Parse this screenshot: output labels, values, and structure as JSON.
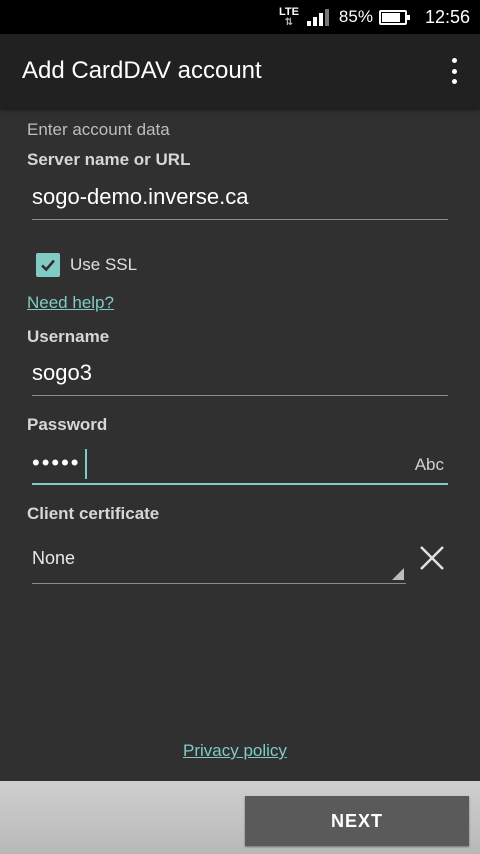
{
  "status_bar": {
    "network": "LTE",
    "battery_percent": "85%",
    "battery_level": 0.85,
    "time": "12:56"
  },
  "app_bar": {
    "title": "Add CardDAV account",
    "menu_icon": "overflow-menu-icon"
  },
  "form": {
    "section_title": "Enter account data",
    "server": {
      "label": "Server name or URL",
      "value": "sogo-demo.inverse.ca"
    },
    "ssl": {
      "label": "Use SSL",
      "checked": true
    },
    "help_link": "Need help?",
    "username": {
      "label": "Username",
      "value": "sogo3"
    },
    "password": {
      "label": "Password",
      "masked_value": "•••••",
      "visibility_toggle": "Abc"
    },
    "client_certificate": {
      "label": "Client certificate",
      "selected": "None",
      "clear_icon": "close-icon"
    }
  },
  "footer": {
    "privacy_link": "Privacy policy",
    "next_button": "NEXT"
  },
  "colors": {
    "accent": "#80cbc4",
    "background": "#303030",
    "app_bar": "#212121",
    "button": "#5a5a5a"
  }
}
